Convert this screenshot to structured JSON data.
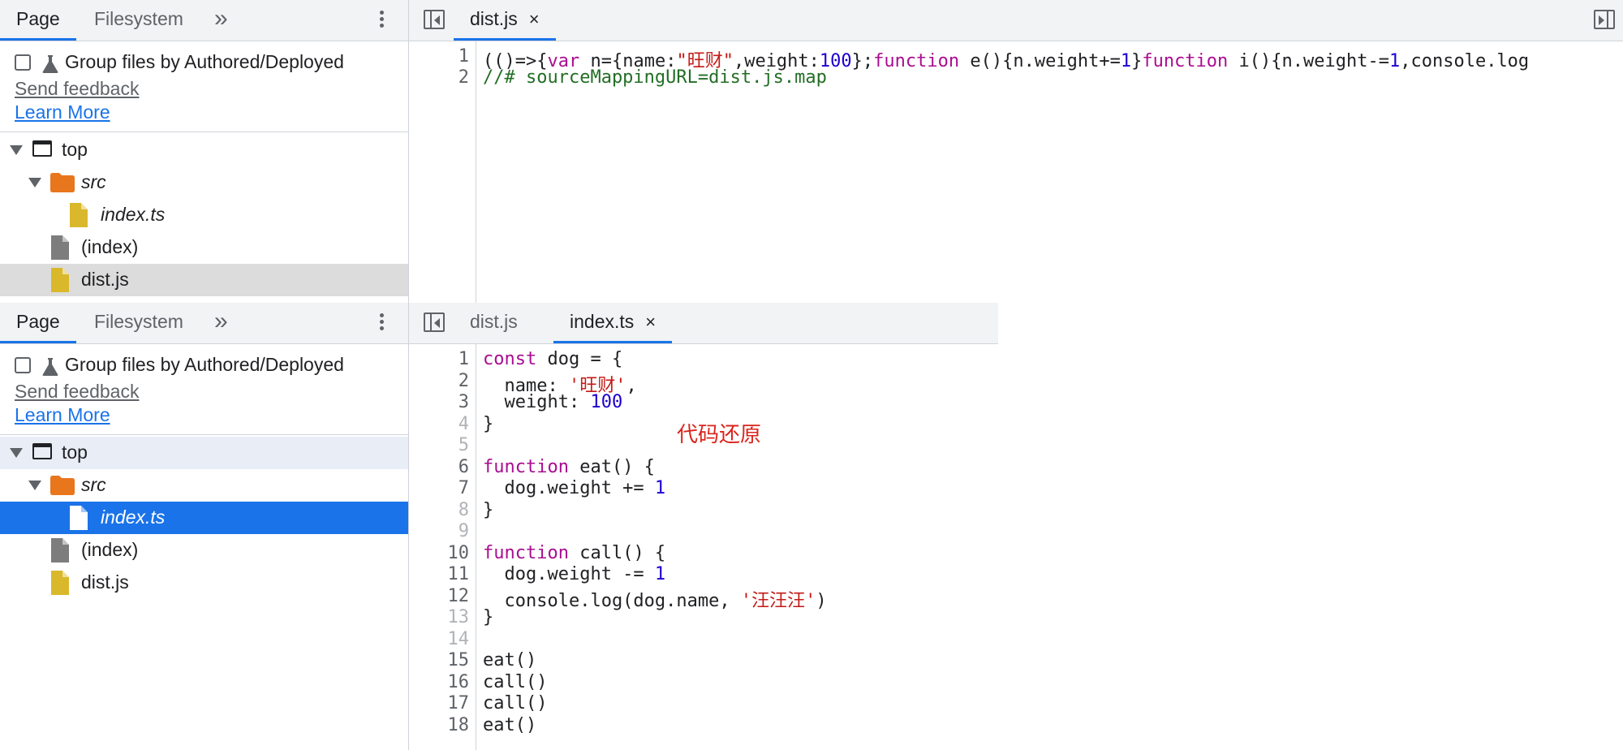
{
  "colors": {
    "accent": "#1a73e8",
    "keyword": "#aa0d91",
    "string": "#c41a16",
    "number": "#1c00cf",
    "comment": "#236e25",
    "annotation": "#d9251d",
    "folder": "#e8761d",
    "file_js": "#d9b92b",
    "file_gray": "#7d7d7d"
  },
  "top_panel": {
    "navigator": {
      "tabs": [
        "Page",
        "Filesystem"
      ],
      "more_tabs_glyph": "»",
      "group_label": "Group files by Authored/Deployed",
      "send_feedback": "Send feedback",
      "learn_more": "Learn More",
      "tree": [
        "top",
        "src",
        "index.ts",
        "(index)",
        "dist.js"
      ]
    },
    "editor": {
      "tabs": [
        "dist.js"
      ],
      "close_glyph": "×",
      "line_numbers": [
        "1",
        "2"
      ],
      "line1": {
        "a": "(()=>{",
        "b": "var",
        "c": " n={name:",
        "d": "\"旺财\"",
        "e": ",weight:",
        "f": "100",
        "g": "};",
        "h": "function",
        "i": " e(){n.weight+=",
        "j": "1",
        "k": "}",
        "l": "function",
        "m": " i(){n.weight-=",
        "n": "1",
        "o": ",console.log"
      },
      "line2": "//# sourceMappingURL=dist.js.map"
    }
  },
  "bottom_panel": {
    "navigator": {
      "tabs": [
        "Page",
        "Filesystem"
      ],
      "more_tabs_glyph": "»",
      "group_label": "Group files by Authored/Deployed",
      "send_feedback": "Send feedback",
      "learn_more": "Learn More",
      "tree": [
        "top",
        "src",
        "index.ts",
        "(index)",
        "dist.js"
      ]
    },
    "editor": {
      "tabs": [
        "dist.js",
        "index.ts"
      ],
      "close_glyph": "×",
      "line_numbers": [
        "1",
        "2",
        "3",
        "4",
        "5",
        "6",
        "7",
        "8",
        "9",
        "10",
        "11",
        "12",
        "13",
        "14",
        "15",
        "16",
        "17",
        "18"
      ],
      "code": {
        "l1": {
          "k": "const",
          "t": " dog = {"
        },
        "l2": {
          "t": "  name: ",
          "s": "'旺财'",
          "e": ","
        },
        "l3": {
          "t": "  weight: ",
          "n": "100"
        },
        "l4": "}",
        "l6": {
          "k": "function",
          "t": " eat() {"
        },
        "l7": {
          "t": "  dog.weight += ",
          "n": "1"
        },
        "l8": "}",
        "l10": {
          "k": "function",
          "t": " call() {"
        },
        "l11": {
          "t": "  dog.weight -= ",
          "n": "1"
        },
        "l12": {
          "t": "  console.log(dog.name, ",
          "s": "'汪汪汪'",
          "e": ")"
        },
        "l13": "}",
        "l15": "eat()",
        "l16": "call()",
        "l17": "call()",
        "l18": "eat()"
      },
      "annotation": "代码还原"
    }
  }
}
